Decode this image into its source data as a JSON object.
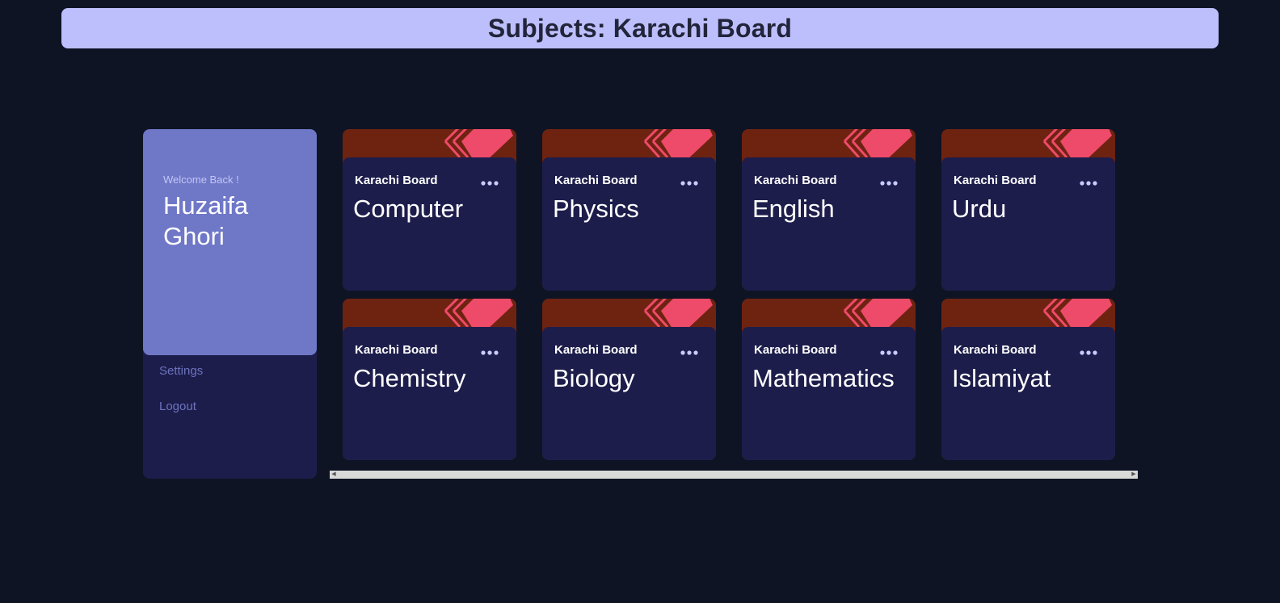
{
  "header": {
    "title": "Subjects: Karachi Board"
  },
  "sidebar": {
    "welcome": "Welcome Back !",
    "user_name": "Huzaifa Ghori",
    "menu": [
      {
        "label": "Settings"
      },
      {
        "label": "Logout"
      }
    ]
  },
  "cards": [
    {
      "board": "Karachi Board",
      "subject": "Computer"
    },
    {
      "board": "Karachi Board",
      "subject": "Physics"
    },
    {
      "board": "Karachi Board",
      "subject": "English"
    },
    {
      "board": "Karachi Board",
      "subject": "Urdu"
    },
    {
      "board": "Karachi Board",
      "subject": "Chemistry"
    },
    {
      "board": "Karachi Board",
      "subject": "Biology"
    },
    {
      "board": "Karachi Board",
      "subject": "Mathematics"
    },
    {
      "board": "Karachi Board",
      "subject": "Islamiyat"
    }
  ],
  "icons": {
    "card_art": "book-stack-icon",
    "card_menu": "more-options-icon",
    "scroll_left": "arrow-left-icon",
    "scroll_right": "arrow-right-icon"
  },
  "colors": {
    "background": "#0e1424",
    "header": "#bdbffd",
    "profile": "#6f77c7",
    "card_body": "#1d1d4c",
    "card_top": "#6e2311",
    "accent": "#ee4a6a"
  }
}
